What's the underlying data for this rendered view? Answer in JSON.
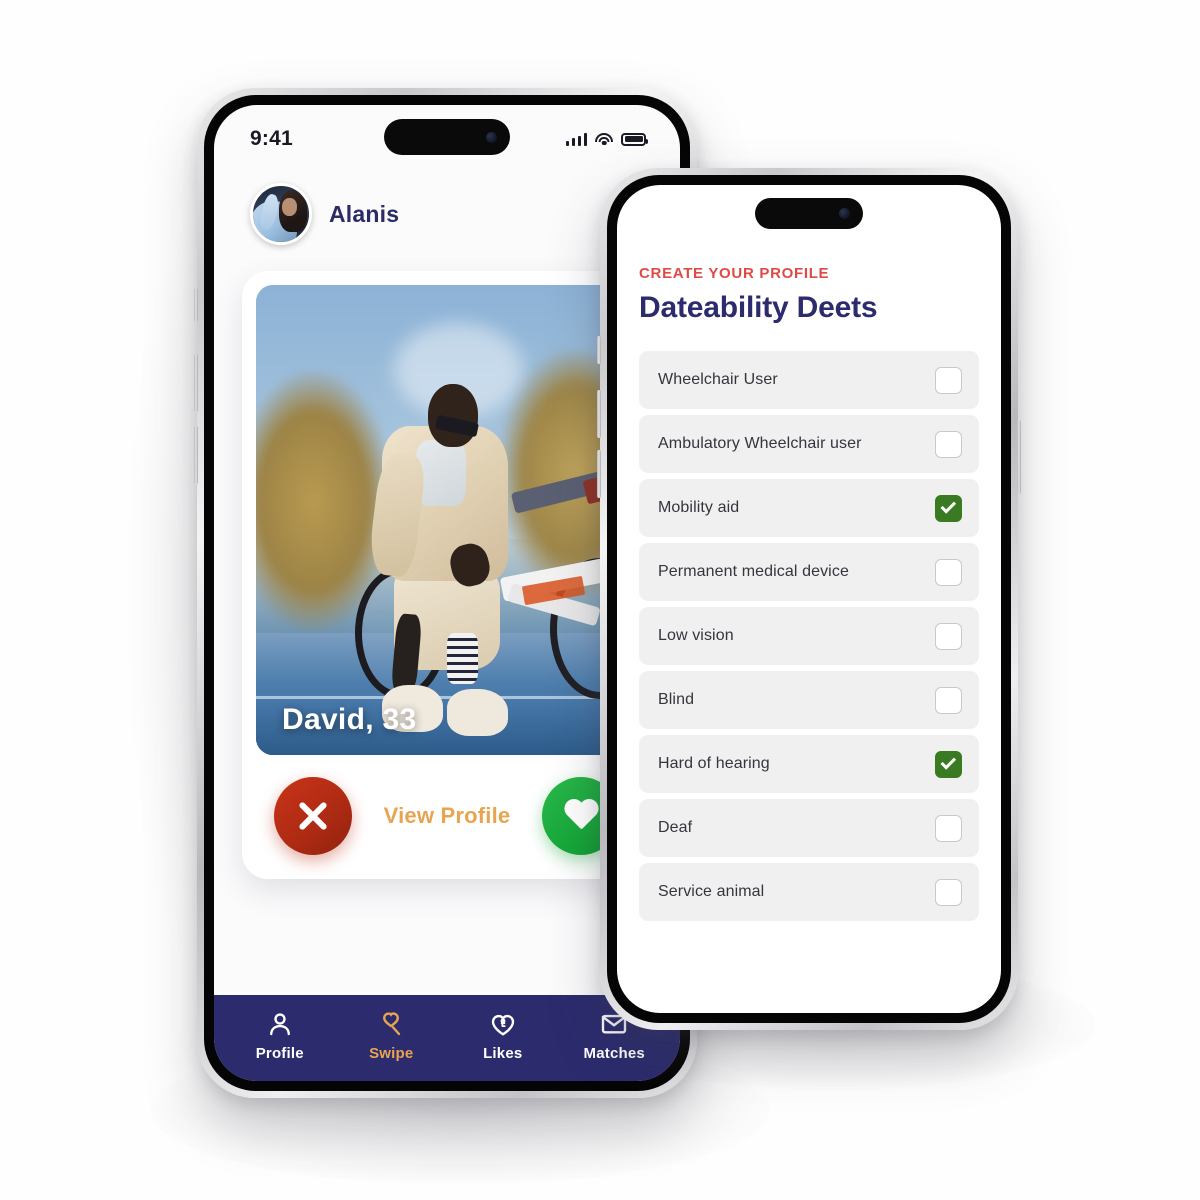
{
  "left_phone": {
    "status_bar": {
      "time": "9:41",
      "signal_icon": "cellular-signal-icon",
      "wifi_icon": "wifi-icon",
      "battery_icon": "battery-icon"
    },
    "header": {
      "avatar_icon": "user-avatar",
      "user_name": "Alanis"
    },
    "swipe_card": {
      "name_age": "David, 33",
      "photo_alt": "man-with-bmx-bike-photo"
    },
    "actions": {
      "reject_label": "reject",
      "reject_icon": "x-icon",
      "view_profile_label": "View Profile",
      "like_label": "like",
      "like_icon": "heart-icon"
    },
    "tabbar": {
      "items": [
        {
          "label": "Profile",
          "icon": "person-icon",
          "active": false
        },
        {
          "label": "Swipe",
          "icon": "heart-magnifier-icon",
          "active": true
        },
        {
          "label": "Likes",
          "icon": "heart-accessibility-icon",
          "active": false
        },
        {
          "label": "Matches",
          "icon": "envelope-heart-icon",
          "active": false
        }
      ]
    }
  },
  "right_phone": {
    "eyebrow": "CREATE YOUR PROFILE",
    "title": "Dateability Deets",
    "options": [
      {
        "label": "Wheelchair User",
        "checked": false
      },
      {
        "label": "Ambulatory Wheelchair user",
        "checked": false
      },
      {
        "label": "Mobility aid",
        "checked": true
      },
      {
        "label": "Permanent medical device",
        "checked": false
      },
      {
        "label": "Low vision",
        "checked": false
      },
      {
        "label": "Blind",
        "checked": false
      },
      {
        "label": "Hard of hearing",
        "checked": true
      },
      {
        "label": "Deaf",
        "checked": false
      },
      {
        "label": "Service animal",
        "checked": false
      }
    ]
  },
  "colors": {
    "navy": "#2b2b6e",
    "red": "#e04a46",
    "green_check": "#3a7a22",
    "orange_accent": "#e8a451",
    "reject_red": "#ad2a12",
    "like_green": "#17a83a",
    "row_bg": "#f0f0f1"
  }
}
